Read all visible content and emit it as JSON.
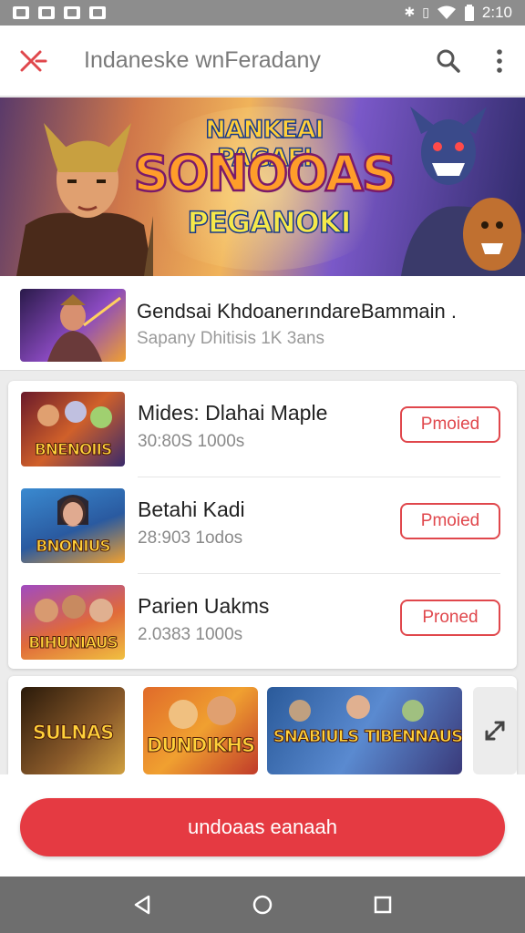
{
  "status_bar": {
    "time": "2:10"
  },
  "app_bar": {
    "title": "Indaneske wnFeradany"
  },
  "hero": {
    "title_top": "NANKEAI PAGAEI",
    "title_main": "SONOOAS",
    "title_sub": "PEGANOKI"
  },
  "featured": {
    "title": "Gendsai KhdoanerındareBammain .",
    "subtitle": "Sapany Dhitisis 1K 3ans"
  },
  "games": [
    {
      "title": "Mides: Dlahai Maple",
      "meta": "30:80S 1000s",
      "button": "Pmoied",
      "thumb_label": "BNENOIIS"
    },
    {
      "title": "Betahi Kadi",
      "meta": "28:903 1odos",
      "button": "Pmoied",
      "thumb_label": "BNONIUS"
    },
    {
      "title": "Parien Uakms",
      "meta": "2.0383 1000s",
      "button": "Proned",
      "thumb_label": "BIHUNIAUS"
    }
  ],
  "carousel": {
    "items": [
      "SULNAS",
      "DUNDIKHS",
      "SNABIULS",
      "TIBENNAUS"
    ]
  },
  "cta": {
    "label": "undoaas eanaah"
  },
  "colors": {
    "accent": "#e53a42",
    "outline_button": "#e0474c"
  }
}
